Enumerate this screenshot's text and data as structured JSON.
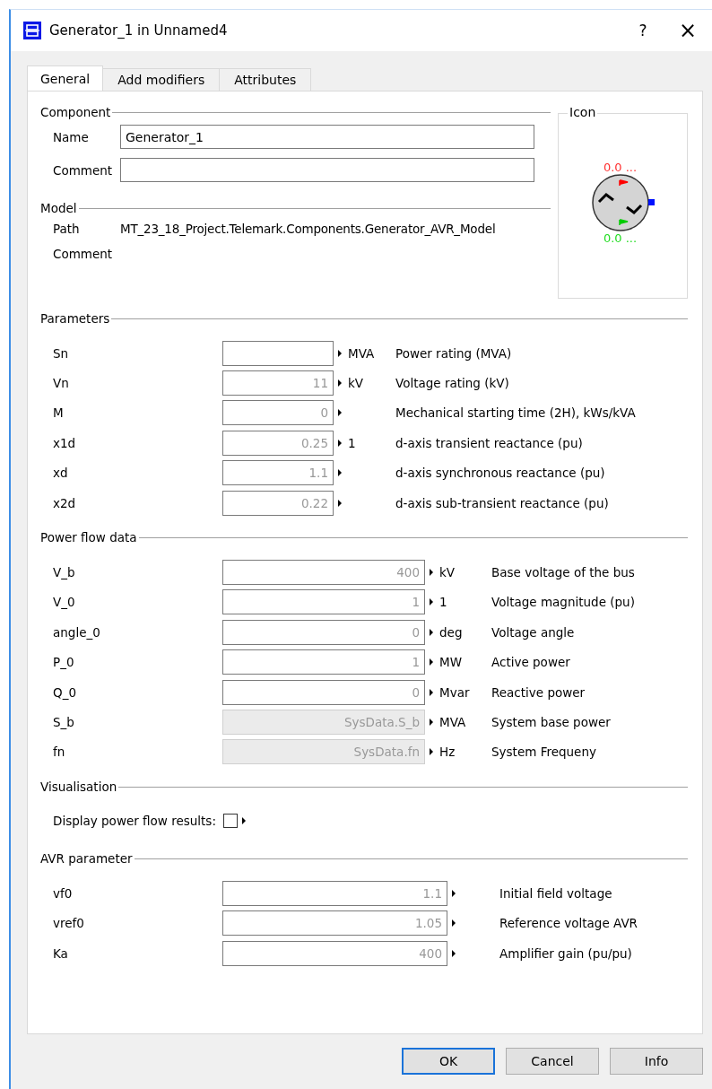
{
  "window": {
    "title": "Generator_1 in Unnamed4",
    "help": "?",
    "close": "×"
  },
  "tabs": [
    {
      "label": "General",
      "selected": true
    },
    {
      "label": "Add modifiers",
      "selected": false
    },
    {
      "label": "Attributes",
      "selected": false
    }
  ],
  "component": {
    "title": "Component",
    "fields": [
      {
        "label": "Name",
        "value": "Generator_1"
      },
      {
        "label": "Comment"
      }
    ]
  },
  "model": {
    "title": "Model",
    "rows": [
      {
        "label": "Path",
        "value": "MT_23_18_Project.Telemark.Components.Generator_AVR_Model"
      },
      {
        "label": "Comment"
      }
    ]
  },
  "icon_panel": {
    "title": "Icon",
    "top_label": "0.0 ...",
    "bottom_label": "0.0 ..."
  },
  "parameters": {
    "title": "Parameters",
    "rows": [
      {
        "name": "Sn",
        "unit": "MVA",
        "description": "Power rating (MVA)",
        "disabled": false
      },
      {
        "name": "Vn",
        "placeholder": "11",
        "unit": "kV",
        "description": "Voltage rating (kV)",
        "disabled": false
      },
      {
        "name": "M",
        "placeholder": "0",
        "description": "Mechanical starting time (2H), kWs/kVA",
        "disabled": false
      },
      {
        "name": "x1d",
        "placeholder": "0.25",
        "unit": "1",
        "description": "d-axis transient reactance (pu)",
        "disabled": false
      },
      {
        "name": "xd",
        "placeholder": "1.1",
        "description": "d-axis synchronous reactance (pu)",
        "disabled": false
      },
      {
        "name": "x2d",
        "placeholder": "0.22",
        "description": "d-axis sub-transient reactance (pu)",
        "disabled": false
      }
    ]
  },
  "power_flow": {
    "title": "Power flow data",
    "rows": [
      {
        "name": "V_b",
        "placeholder": "400",
        "unit": "kV",
        "description": "Base voltage of the bus",
        "disabled": false
      },
      {
        "name": "V_0",
        "placeholder": "1",
        "unit": "1",
        "description": "Voltage magnitude (pu)",
        "disabled": false
      },
      {
        "name": "angle_0",
        "placeholder": "0",
        "unit": "deg",
        "description": "Voltage angle",
        "disabled": false
      },
      {
        "name": "P_0",
        "placeholder": "1",
        "unit": "MW",
        "description": "Active power",
        "disabled": false
      },
      {
        "name": "Q_0",
        "placeholder": "0",
        "unit": "Mvar",
        "description": "Reactive power",
        "disabled": false
      },
      {
        "name": "S_b",
        "placeholder": "SysData.S_b",
        "unit": "MVA",
        "description": "System base power",
        "disabled": true
      },
      {
        "name": "fn",
        "placeholder": "SysData.fn",
        "unit": "Hz",
        "description": "System Frequeny",
        "disabled": true
      }
    ]
  },
  "visualisation": {
    "title": "Visualisation",
    "label": "Display power flow results:",
    "checked": false
  },
  "avr": {
    "title": "AVR parameter",
    "rows": [
      {
        "name": "vf0",
        "placeholder": "1.1",
        "description": "Initial field voltage",
        "disabled": false
      },
      {
        "name": "vref0",
        "placeholder": "1.05",
        "description": "Reference voltage AVR",
        "disabled": false
      },
      {
        "name": "Ka",
        "placeholder": "400",
        "description": "Amplifier gain (pu/pu)",
        "disabled": false
      }
    ]
  },
  "buttons": [
    {
      "label": "OK",
      "default": true
    },
    {
      "label": "Cancel",
      "default": false
    },
    {
      "label": "Info",
      "default": false
    }
  ]
}
